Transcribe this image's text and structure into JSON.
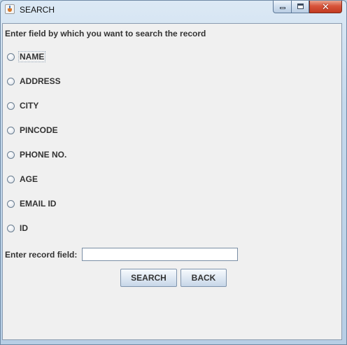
{
  "window": {
    "title": "SEARCH",
    "close_glyph": "✕"
  },
  "form": {
    "prompt": "Enter field by which you want to search the record",
    "options": [
      {
        "label": "NAME"
      },
      {
        "label": "ADDRESS"
      },
      {
        "label": "CITY"
      },
      {
        "label": "PINCODE"
      },
      {
        "label": "PHONE NO."
      },
      {
        "label": "AGE"
      },
      {
        "label": "EMAIL ID"
      },
      {
        "label": "ID"
      }
    ],
    "field_label": "Enter record field:",
    "field_value": "",
    "search_label": "SEARCH",
    "back_label": "BACK"
  },
  "icons": {
    "app": "java-coffee-cup-icon",
    "minimize": "minimize-icon",
    "maximize": "maximize-icon",
    "close": "close-icon"
  },
  "colors": {
    "panel_bg": "#f0f0f0",
    "close_button": "#c9452b",
    "text": "#333333"
  }
}
